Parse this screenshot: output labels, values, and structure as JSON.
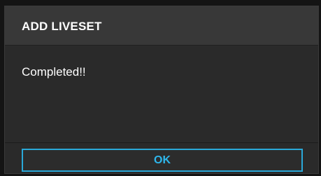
{
  "dialog": {
    "title": "ADD LIVESET",
    "message": "Completed!!",
    "ok_label": "OK"
  },
  "colors": {
    "accent": "#2aa8d8",
    "header_bg": "#383838",
    "body_bg": "#2a2a2a",
    "text": "#ffffff"
  }
}
